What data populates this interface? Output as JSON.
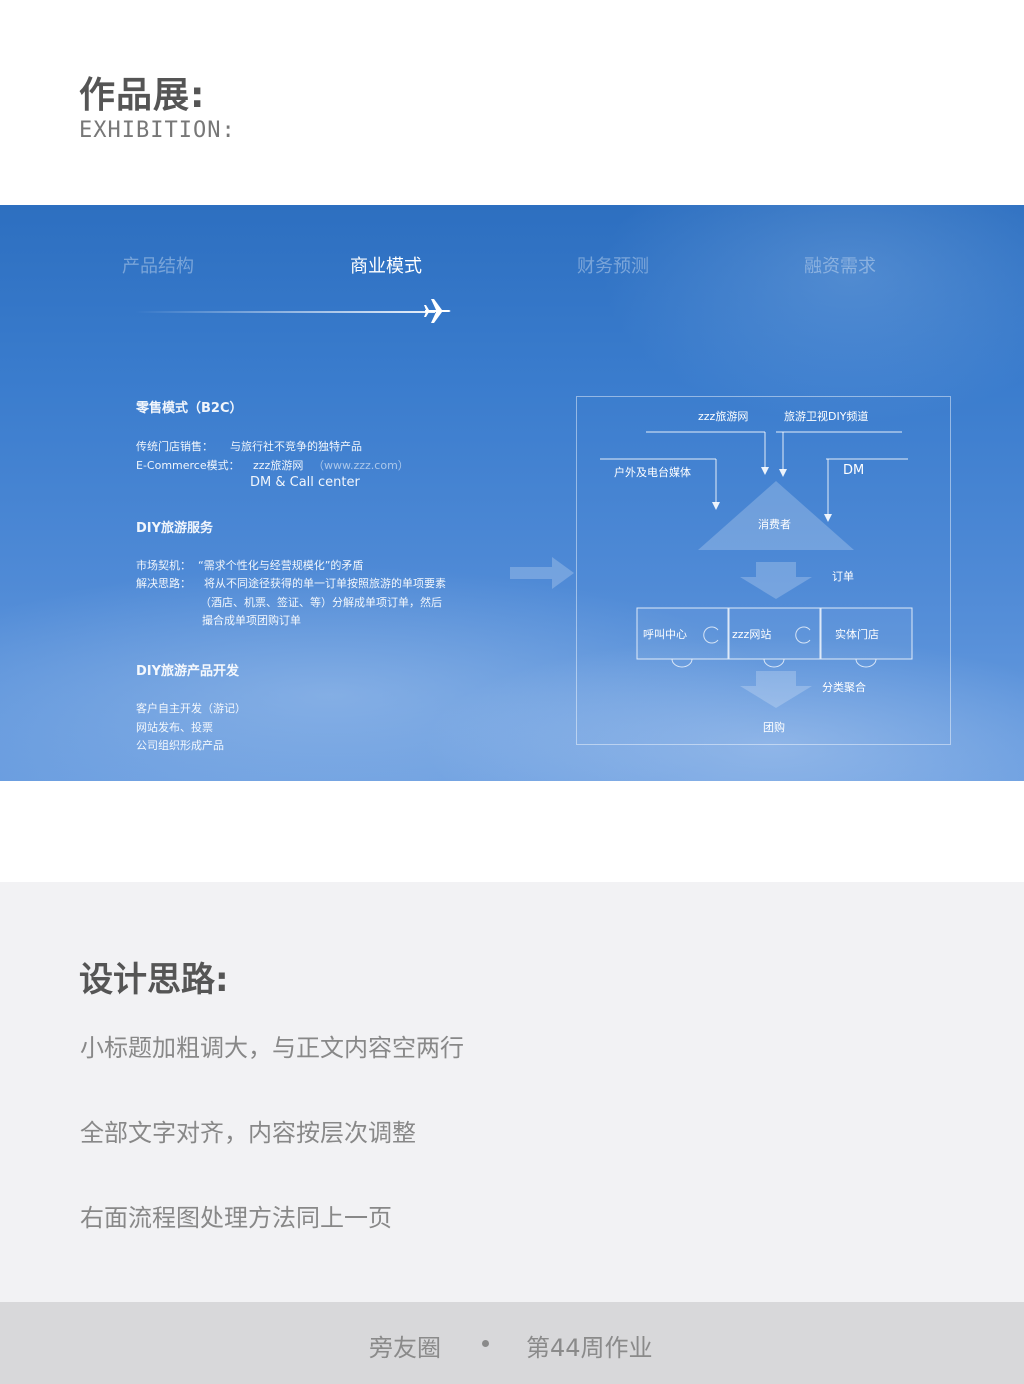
{
  "header": {
    "title": "作品展:",
    "subtitle": "EXHIBITION:"
  },
  "slide": {
    "tabs": [
      {
        "label": "产品结构",
        "active": false
      },
      {
        "label": "商业模式",
        "active": true
      },
      {
        "label": "财务预测",
        "active": false
      },
      {
        "label": "融资需求",
        "active": false
      }
    ],
    "icon": "airplane-icon",
    "sections": {
      "retail": {
        "heading": "零售模式（B2C）",
        "line1_label": "传统门店销售：",
        "line1_value": "与旅行社不竞争的独特产品",
        "line2_label": "E-Commerce模式：",
        "line2_value": "zzz旅游网",
        "line2_url": "（www.zzz.com）",
        "line3_value": "DM & Call center"
      },
      "diy_service": {
        "heading": "DIY旅游服务",
        "line1_label": "市场契机：",
        "line1_value": "“需求个性化与经营规模化”的矛盾",
        "line2_label": "解决思路：",
        "line2_value": "将从不同途径获得的单一订单按照旅游的单项要素",
        "line3_value": "（酒店、机票、签证、等）分解成单项订单，然后",
        "line4_value": "撮合成单项团购订单"
      },
      "diy_product": {
        "heading": "DIY旅游产品开发",
        "items": [
          "客户自主开发（游记）",
          "网站发布、投票",
          "公司组织形成产品"
        ]
      }
    },
    "diagram": {
      "zzz_site": "zzz旅游网",
      "tv_channel": "旅游卫视DIY频道",
      "outdoor_media": "户外及电台媒体",
      "dm": "DM",
      "consumer": "消费者",
      "order": "订单",
      "call_center": "呼叫中心",
      "zzz_web": "zzz网站",
      "store": "实体门店",
      "aggregate": "分类聚合",
      "group_buy": "团购"
    }
  },
  "design": {
    "heading": "设计思路:",
    "notes": [
      "小标题加粗调大，与正文内容空两行",
      "全部文字对齐，内容按层次调整",
      "右面流程图处理方法同上一页"
    ]
  },
  "footer": {
    "brand": "旁友圈",
    "issue": "第44周作业"
  }
}
